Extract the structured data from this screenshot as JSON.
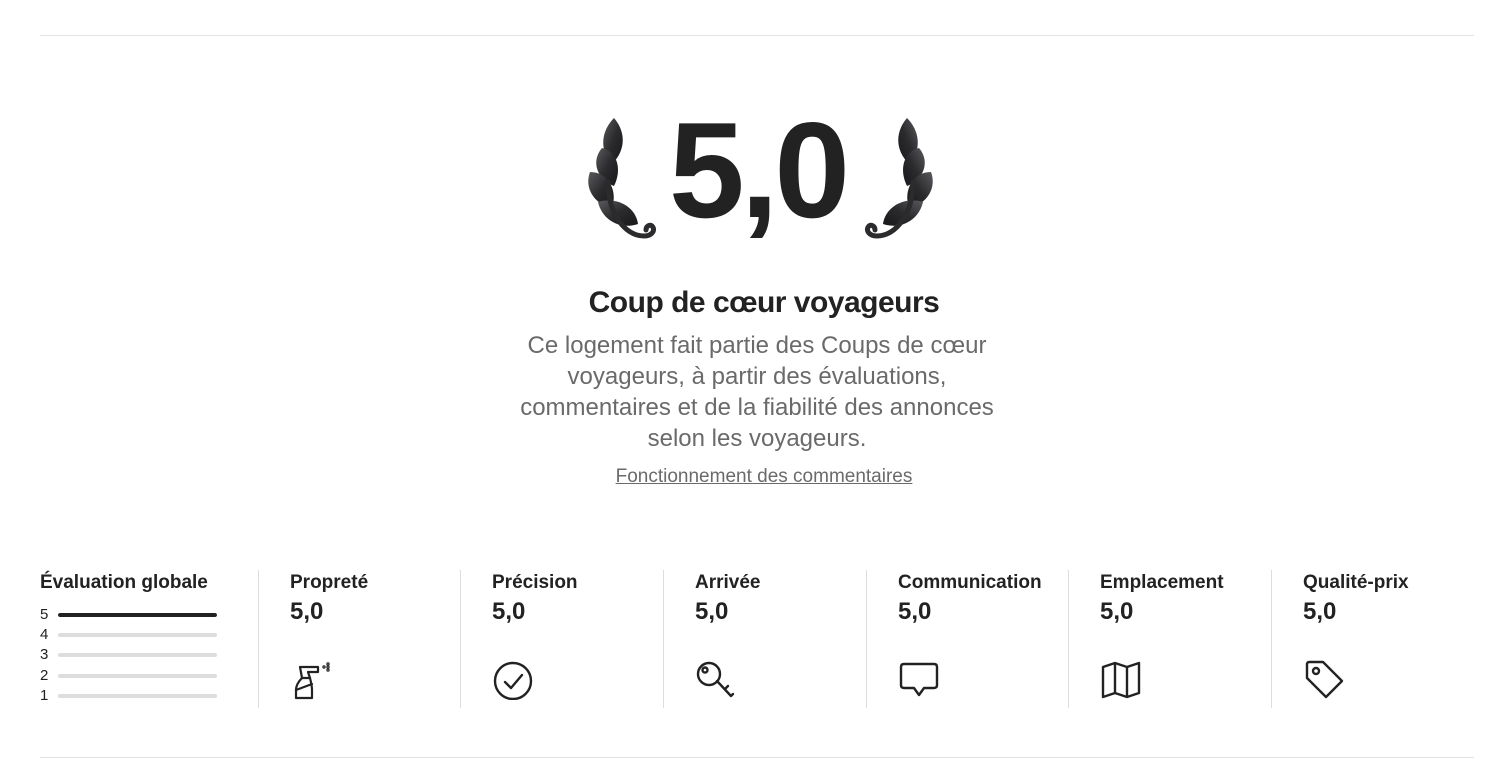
{
  "hero": {
    "score": "5,0",
    "title": "Coup de cœur voyageurs",
    "description": "Ce logement fait partie des Coups de cœur voyageurs, à partir des évaluations, commentaires et de la fiabilité des annonces selon les voyageurs.",
    "link_label": "Fonctionnement des commentaires"
  },
  "overall": {
    "title": "Évaluation globale",
    "distribution": [
      {
        "stars": "5",
        "share": 1.0
      },
      {
        "stars": "4",
        "share": 0.0
      },
      {
        "stars": "3",
        "share": 0.0
      },
      {
        "stars": "2",
        "share": 0.0
      },
      {
        "stars": "1",
        "share": 0.0
      }
    ]
  },
  "categories": [
    {
      "label": "Propreté",
      "value": "5,0",
      "icon": "spray-bottle-icon"
    },
    {
      "label": "Précision",
      "value": "5,0",
      "icon": "check-circle-icon"
    },
    {
      "label": "Arrivée",
      "value": "5,0",
      "icon": "key-icon"
    },
    {
      "label": "Communication",
      "value": "5,0",
      "icon": "speech-bubble-icon"
    },
    {
      "label": "Emplacement",
      "value": "5,0",
      "icon": "map-icon"
    },
    {
      "label": "Qualité-prix",
      "value": "5,0",
      "icon": "price-tag-icon"
    }
  ],
  "colors": {
    "text": "#222222",
    "muted": "#6a6a6a",
    "divider": "#dddddd",
    "bar_track": "#dddddd",
    "bar_fill": "#222222"
  }
}
